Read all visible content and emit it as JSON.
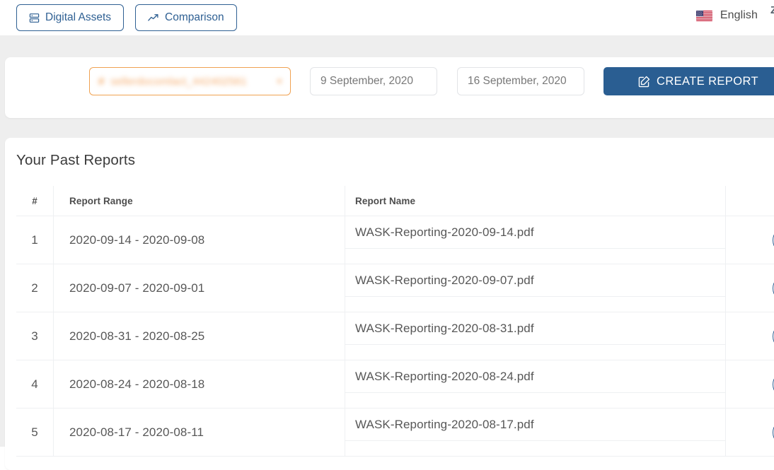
{
  "topbar": {
    "nav": [
      {
        "label": "Digital Assets",
        "icon": "server-stack-icon"
      },
      {
        "label": "Comparison",
        "icon": "trend-arrow-icon"
      }
    ],
    "language": {
      "label": "English",
      "icon": "us-flag-icon"
    },
    "edge_cut_text": "Z"
  },
  "filters": {
    "account_select": {
      "value": "sellerdocomlact_442402561",
      "marker": "#",
      "caret": "▾",
      "redacted": true,
      "border_color": "#f0a252"
    },
    "date_from": "9 September, 2020",
    "date_to": "16 September, 2020",
    "create_report": {
      "label": "CREATE REPORT",
      "icon": "edit-pencil-square-icon",
      "color": "#2a5e92"
    }
  },
  "reports": {
    "title": "Your Past Reports",
    "columns": [
      "#",
      "Report Range",
      "Report Name",
      ""
    ],
    "rows": [
      {
        "num": "1",
        "range": "2020-09-14 - 2020-09-08",
        "name": "WASK-Reporting-2020-09-14.pdf",
        "action_icon": "download-circle-icon"
      },
      {
        "num": "2",
        "range": "2020-09-07 - 2020-09-01",
        "name": "WASK-Reporting-2020-09-07.pdf",
        "action_icon": "download-circle-icon"
      },
      {
        "num": "3",
        "range": "2020-08-31 - 2020-08-25",
        "name": "WASK-Reporting-2020-08-31.pdf",
        "action_icon": "download-circle-icon"
      },
      {
        "num": "4",
        "range": "2020-08-24 - 2020-08-18",
        "name": "WASK-Reporting-2020-08-24.pdf",
        "action_icon": "download-circle-icon"
      },
      {
        "num": "5",
        "range": "2020-08-17 - 2020-08-11",
        "name": "WASK-Reporting-2020-08-17.pdf",
        "action_icon": "download-circle-icon"
      }
    ]
  },
  "theme": {
    "accent_blue": "#2f6093",
    "button_blue": "#2a5e92",
    "page_bg": "#eeeeee",
    "card_bg": "#ffffff",
    "border": "#eef0f2",
    "text": "#575757",
    "orange": "#f0a252"
  }
}
